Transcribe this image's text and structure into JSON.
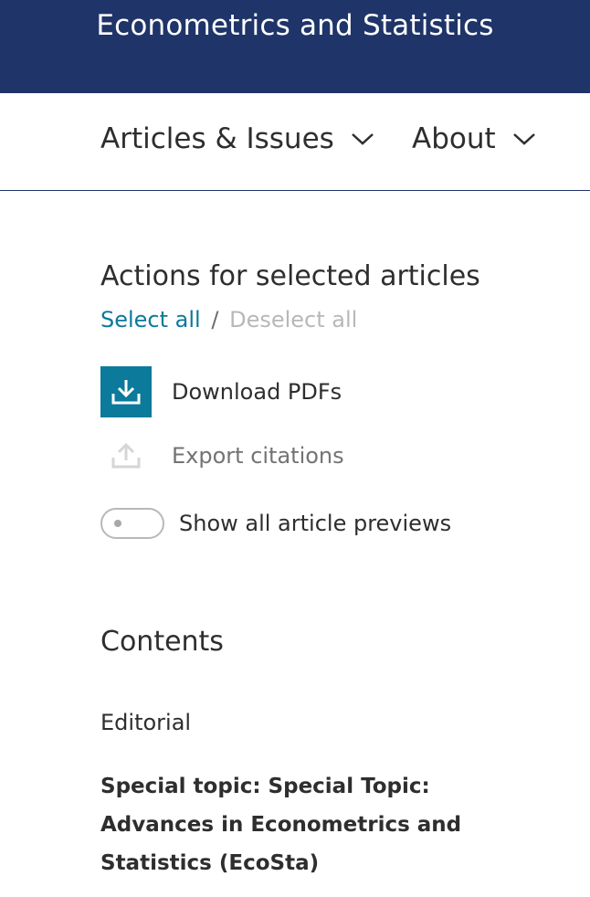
{
  "header": {
    "journal_title": "Econometrics and Statistics"
  },
  "nav": {
    "items": [
      {
        "label": "Articles & Issues",
        "icon": "chevron-down-icon"
      },
      {
        "label": "About",
        "icon": "chevron-down-icon"
      }
    ]
  },
  "actions": {
    "title": "Actions for selected articles",
    "select_all": "Select all",
    "separator": "/",
    "deselect_all": "Deselect all",
    "download_label": "Download PDFs",
    "download_icon": "download-icon",
    "export_label": "Export citations",
    "export_icon": "export-icon",
    "preview_toggle_label": "Show all article previews",
    "preview_toggle_on": false
  },
  "contents": {
    "title": "Contents",
    "editorial": "Editorial",
    "special_topic": "Special topic: Special Topic: Advances in Econometrics and Statistics (EcoSta)"
  },
  "colors": {
    "header_bg": "#1f3468",
    "accent": "#0c7a9a",
    "disabled": "#b8b8b8"
  }
}
